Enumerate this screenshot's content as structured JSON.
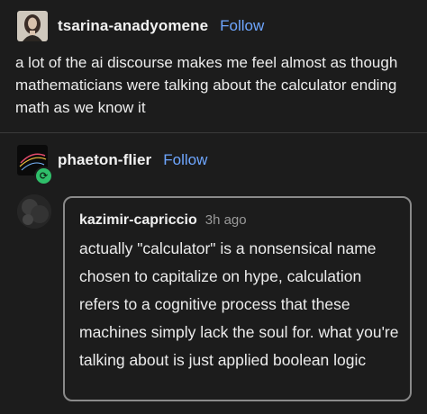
{
  "original_post": {
    "username": "tsarina-anadyomene",
    "follow_label": "Follow",
    "text": "a lot of the ai discourse makes me feel almost as though mathematicians were talking about the calculator ending math as we know it"
  },
  "reblog": {
    "username": "phaeton-flier",
    "follow_label": "Follow",
    "badge_icon": "reblog-icon"
  },
  "comment": {
    "username": "kazimir-capriccio",
    "timestamp": "3h ago",
    "text": "actually \"calculator\" is a nonsensical name chosen to capitalize on hype, calculation refers to a cognitive process that these machines simply lack the soul for. what you're talking about is just applied boolean logic"
  },
  "colors": {
    "background": "#1c1c1c",
    "link": "#6ea6ff",
    "badge": "#2fbf6a",
    "border": "#8a8a8a"
  }
}
